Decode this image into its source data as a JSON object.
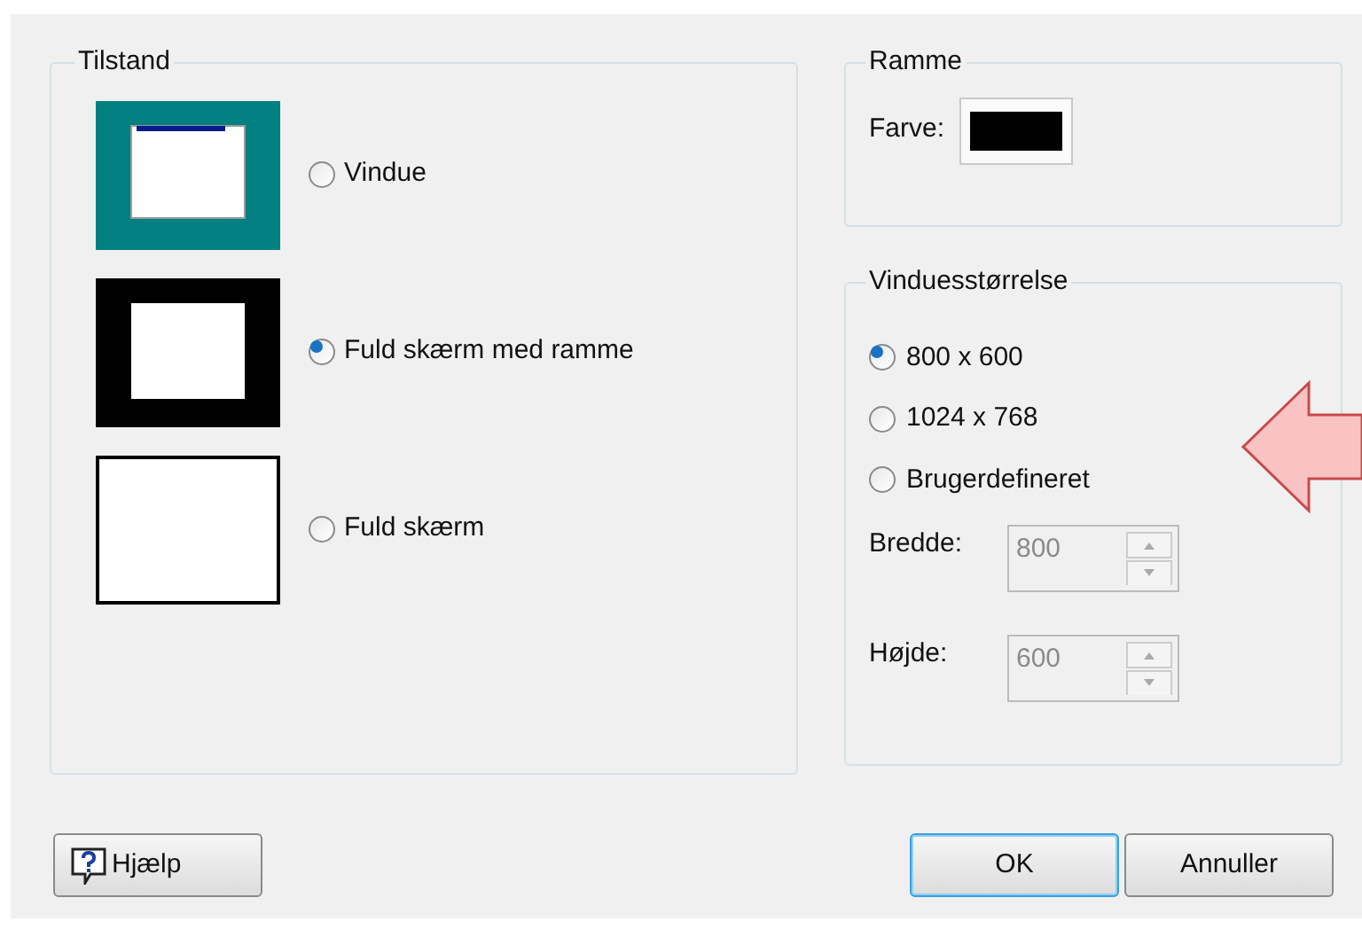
{
  "mode_group": {
    "title": "Tilstand",
    "options": [
      {
        "kind": "window",
        "label": "Vindue",
        "selected": false
      },
      {
        "kind": "framed",
        "label": "Fuld skærm med ramme",
        "selected": true
      },
      {
        "kind": "full",
        "label": "Fuld skærm",
        "selected": false
      }
    ]
  },
  "frame_group": {
    "title": "Ramme",
    "color_label": "Farve:",
    "color": "#000000"
  },
  "size_group": {
    "title": "Vinduesstørrelse",
    "options": [
      {
        "label": "800 x 600",
        "selected": true
      },
      {
        "label": "1024 x 768",
        "selected": false
      },
      {
        "label": "Brugerdefineret",
        "selected": false
      }
    ],
    "fields": [
      {
        "label": "Bredde:",
        "value": "800",
        "disabled": true
      },
      {
        "label": "Højde:",
        "value": "600",
        "disabled": true
      }
    ]
  },
  "buttons": [
    {
      "kind": "help",
      "label": "Hjælp",
      "default": false
    },
    {
      "kind": "ok",
      "label": "OK",
      "default": true
    },
    {
      "kind": "cancel",
      "label": "Annuller",
      "default": false
    }
  ]
}
